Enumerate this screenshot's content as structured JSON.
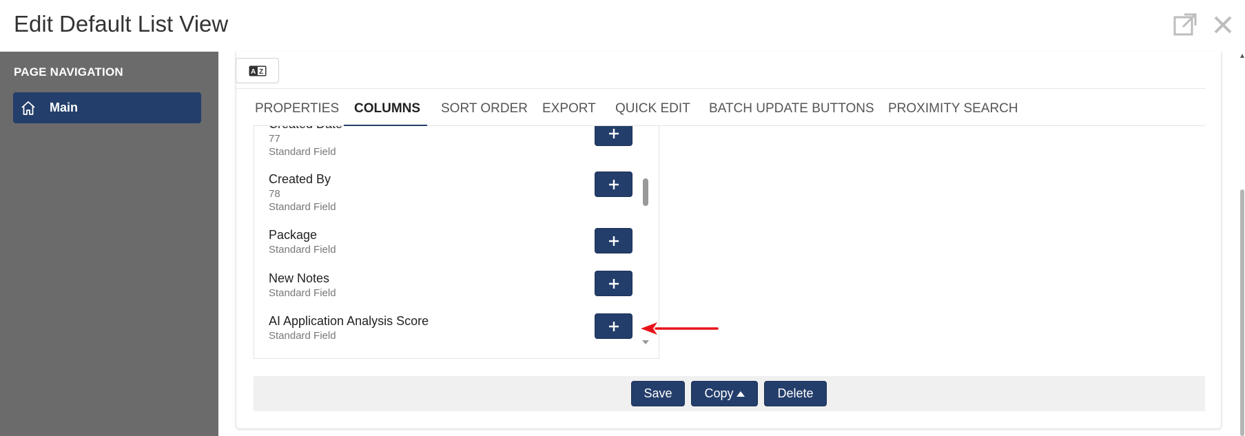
{
  "window": {
    "title": "Edit Default List View",
    "popout_icon": "popout-icon",
    "close_icon": "close-icon"
  },
  "sidebar": {
    "heading": "PAGE NAVIGATION",
    "items": [
      {
        "label": "Main",
        "icon": "home-icon",
        "active": true
      }
    ]
  },
  "toolbar": {
    "translate_icon": "translate-icon"
  },
  "tabs": [
    {
      "label": "PROPERTIES",
      "active": false
    },
    {
      "label": "COLUMNS",
      "active": true
    },
    {
      "label": "SORT ORDER",
      "active": false
    },
    {
      "label": "EXPORT",
      "active": false
    },
    {
      "label": "QUICK EDIT",
      "active": false
    },
    {
      "label": "BATCH UPDATE BUTTONS",
      "active": false
    },
    {
      "label": "PROXIMITY SEARCH",
      "active": false
    }
  ],
  "fields": [
    {
      "name": "Created Date",
      "id": "77",
      "type": "Standard Field"
    },
    {
      "name": "Created By",
      "id": "78",
      "type": "Standard Field"
    },
    {
      "name": "Package",
      "id": "",
      "type": "Standard Field"
    },
    {
      "name": "New Notes",
      "id": "",
      "type": "Standard Field"
    },
    {
      "name": "AI Application Analysis Score",
      "id": "",
      "type": "Standard Field"
    }
  ],
  "footer": {
    "save_label": "Save",
    "copy_label": "Copy",
    "delete_label": "Delete"
  },
  "colors": {
    "primary": "#243e6b",
    "sidebar_bg": "#6b6b6b",
    "annotation": "#e8141b"
  }
}
